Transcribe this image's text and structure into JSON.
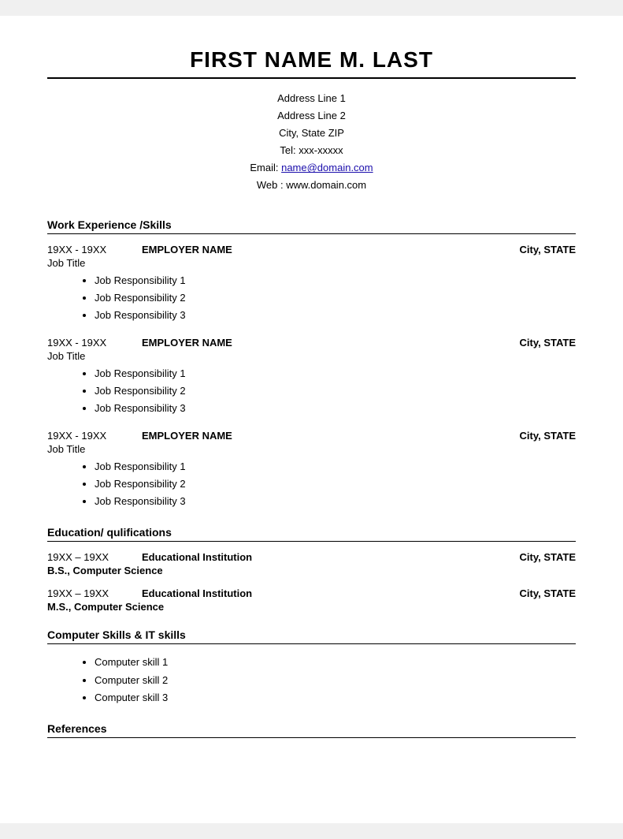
{
  "header": {
    "name": "FIRST NAME M. LAST"
  },
  "contact": {
    "address_line1": "Address Line 1",
    "address_line2": "Address Line 2",
    "city_state_zip": "City, State ZIP",
    "tel_label": "Tel: xxx-xxxxx",
    "email_label": "Email: ",
    "email_link_text": "name@domain.com",
    "email_link_href": "mailto:name@domain.com",
    "web_label": "Web : www.domain.com"
  },
  "sections": {
    "work_experience": {
      "title": "Work Experience /Skills",
      "jobs": [
        {
          "dates": "19XX - 19XX",
          "employer": "EMPLOYER NAME",
          "city": "City, STATE",
          "title": "Job Title",
          "responsibilities": [
            "Job Responsibility 1",
            "Job Responsibility 2",
            "Job Responsibility 3"
          ]
        },
        {
          "dates": "19XX - 19XX",
          "employer": "EMPLOYER NAME",
          "city": "City, STATE",
          "title": "Job Title",
          "responsibilities": [
            "Job Responsibility 1",
            "Job Responsibility 2",
            "Job Responsibility 3"
          ]
        },
        {
          "dates": "19XX - 19XX",
          "employer": "EMPLOYER NAME",
          "city": "City, STATE",
          "title": "Job Title",
          "responsibilities": [
            "Job Responsibility 1",
            "Job Responsibility 2",
            "Job Responsibility 3"
          ]
        }
      ]
    },
    "education": {
      "title": "Education/ qulifications",
      "entries": [
        {
          "dates": "19XX – 19XX",
          "institution": "Educational Institution",
          "city": "City, STATE",
          "degree": "B.S., Computer Science"
        },
        {
          "dates": "19XX – 19XX",
          "institution": "Educational Institution",
          "city": "City, STATE",
          "degree": "M.S., Computer Science"
        }
      ]
    },
    "computer_skills": {
      "title": "Computer Skills & IT skills",
      "skills": [
        "Computer skill 1",
        "Computer skill 2",
        "Computer skill 3"
      ]
    },
    "references": {
      "title": "References"
    }
  }
}
